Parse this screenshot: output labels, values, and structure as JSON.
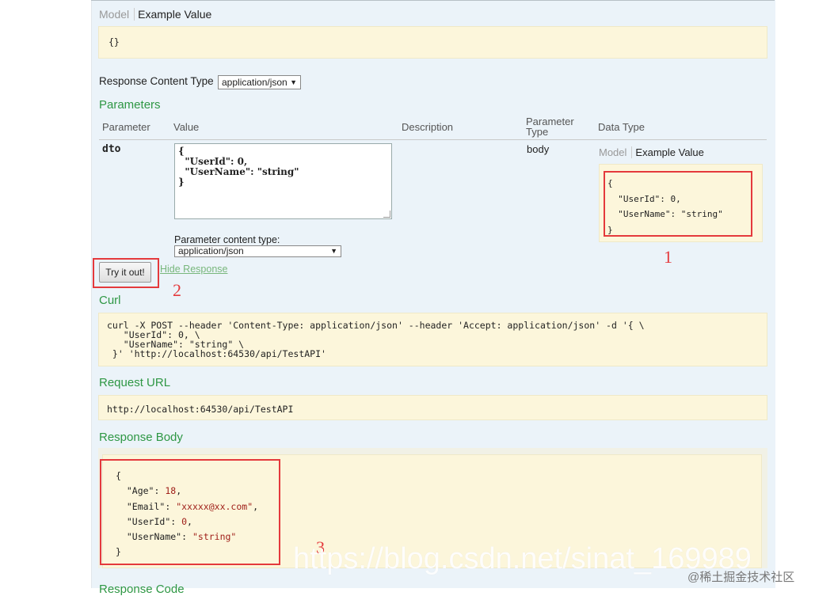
{
  "top_tabs": {
    "model": "Model",
    "example": "Example Value"
  },
  "top_snippet": "{}",
  "response_content_type": {
    "label": "Response Content Type",
    "value": "application/json"
  },
  "parameters": {
    "title": "Parameters",
    "headers": {
      "parameter": "Parameter",
      "value": "Value",
      "description": "Description",
      "ptype_line1": "Parameter",
      "ptype_line2": "Type",
      "data_type": "Data Type"
    },
    "row": {
      "name": "dto",
      "value_lines": [
        "{",
        "  \"UserId\": 0,",
        "  \"UserName\": \"string\"",
        "}"
      ],
      "type": "body",
      "model_tab": "Model",
      "example_tab": "Example Value",
      "example_lines": [
        "{",
        "  \"UserId\": 0,",
        "  \"UserName\": \"string\"",
        "}"
      ],
      "content_type_label": "Parameter content type:",
      "content_type_value": "application/json"
    }
  },
  "actions": {
    "try_button": "Try it out!",
    "hide_link": "Hide Response"
  },
  "annotations": {
    "n1": "1",
    "n2": "2",
    "n3": "3"
  },
  "curl": {
    "title": "Curl",
    "lines": [
      "curl -X POST --header 'Content-Type: application/json' --header 'Accept: application/json' -d '{ \\",
      "   \"UserId\": 0, \\",
      "   \"UserName\": \"string\" \\",
      " }' 'http://localhost:64530/api/TestAPI'"
    ]
  },
  "request_url": {
    "title": "Request URL",
    "value": "http://localhost:64530/api/TestAPI"
  },
  "response_body": {
    "title": "Response Body",
    "open": "{",
    "fields": [
      {
        "key": "\"Age\"",
        "value": "18",
        "kind": "n",
        "comma": ","
      },
      {
        "key": "\"Email\"",
        "value": "\"xxxxx@xx.com\"",
        "kind": "s",
        "comma": ","
      },
      {
        "key": "\"UserId\"",
        "value": "0",
        "kind": "n",
        "comma": ","
      },
      {
        "key": "\"UserName\"",
        "value": "\"string\"",
        "kind": "s",
        "comma": ""
      }
    ],
    "close": "}"
  },
  "next_section_partial": "Response Code",
  "watermark": "https://blog.csdn.net/sinat_169989",
  "watermark2": "@稀土掘金技术社区",
  "colors": {
    "accent_green": "#2e9744",
    "snippet_bg": "#fcf6db",
    "annotation_red": "#e4393c"
  }
}
